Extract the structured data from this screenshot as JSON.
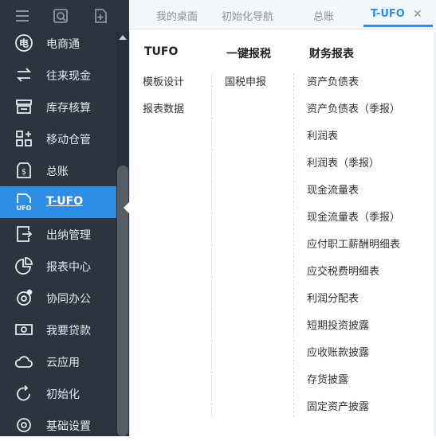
{
  "sidebar": {
    "toolbar": [
      {
        "icon": "hamburger-menu-icon"
      },
      {
        "icon": "search-doc-icon"
      },
      {
        "icon": "new-doc-icon"
      }
    ],
    "items": [
      {
        "label": "电商通",
        "icon": "ecommerce-icon"
      },
      {
        "label": "往来现金",
        "icon": "exchange-icon"
      },
      {
        "label": "库存核算",
        "icon": "inventory-icon"
      },
      {
        "label": "移动仓管",
        "icon": "grid-plus-icon"
      },
      {
        "label": "总账",
        "icon": "ledger-icon"
      },
      {
        "label": "T-UFO",
        "icon": "ufo-icon",
        "active": true
      },
      {
        "label": "出纳管理",
        "icon": "cashier-icon"
      },
      {
        "label": "报表中心",
        "icon": "pie-chart-icon"
      },
      {
        "label": "协同办公",
        "icon": "collab-icon"
      },
      {
        "label": "我要贷款",
        "icon": "loan-icon"
      },
      {
        "label": "云应用",
        "icon": "cloud-icon"
      },
      {
        "label": "初始化",
        "icon": "refresh-icon"
      },
      {
        "label": "基础设置",
        "icon": "settings-icon"
      }
    ]
  },
  "tabs": [
    {
      "label": "我的桌面"
    },
    {
      "label": "初始化导航"
    },
    {
      "label": "总账"
    },
    {
      "label": "T-UFO",
      "active": true
    }
  ],
  "menu": {
    "columns": [
      {
        "title": "TUFO",
        "items": [
          "模板设计",
          "报表数据"
        ]
      },
      {
        "title": "一键报税",
        "items": [
          "国税申报"
        ]
      },
      {
        "title": "财务报表",
        "items": [
          "资产负债表",
          "资产负债表（季报）",
          "利润表",
          "利润表（季报）",
          "现金流量表",
          "现金流量表（季报）",
          "应付职工薪酬明细表",
          "应交税费明细表",
          "利润分配表",
          "短期投资披露",
          "应收账款披露",
          "存货披露",
          "固定资产披露"
        ]
      }
    ]
  },
  "colors": {
    "sidebar_bg": "#2c3440",
    "accent": "#2e8ee6"
  }
}
